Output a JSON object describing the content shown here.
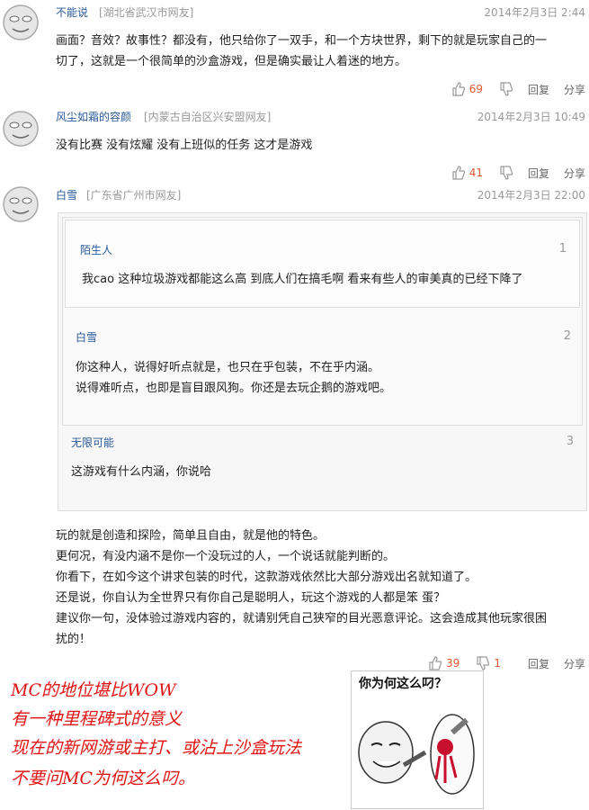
{
  "comments": [
    {
      "user": "不能说",
      "location": "[湖北省武汉市网友]",
      "time": "2014年2月3日 2:44",
      "text_lines": [
        "画面？音效？故事性？都没有，他只给你了一双手，和一个方块世界，剩下的就是玩家自己的一",
        "切了，这就是一个很简单的沙盒游戏，但是确实最让人着迷的地方。"
      ],
      "likes": "69",
      "reply_label": "回复",
      "share_label": "分享"
    },
    {
      "user": "风尘如霜的容颜",
      "location": "[内蒙古自治区兴安盟网友]",
      "time": "2014年2月3日 10:49",
      "text_lines": [
        "没有比赛  没有炫耀  没有上班似的任务  这才是游戏"
      ],
      "likes": "41",
      "reply_label": "回复",
      "share_label": "分享"
    },
    {
      "user": "白雪",
      "location": "[广东省广州市网友]",
      "time": "2014年2月3日 22:00",
      "quotes": [
        {
          "user": "陌生人",
          "num": "1",
          "lines": [
            "我cao 这种垃圾游戏都能这么高 到底人们在搞毛啊 看来有些人的审美真的已经下降了"
          ]
        },
        {
          "user": "白雪",
          "num": "2",
          "lines": [
            "你这种人，说得好听点就是，也只在乎包装，不在乎内涵。",
            "说得难听点，也即是盲目跟风狗。你还是去玩企鹅的游戏吧。"
          ]
        },
        {
          "user": "无限可能",
          "num": "3",
          "lines": [
            "这游戏有什么内涵，你说哈"
          ]
        }
      ],
      "text_lines": [
        "玩的就是创造和探险，简单且自由，就是他的特色。",
        "更何况，有没内涵不是你一个没玩过的人，一个说话就能判断的。",
        "你看下，在如今这个讲求包装的时代，这款游戏依然比大部分游戏出名就知道了。",
        "还是说，你自认为全世界只有你自己是聪明人，玩这个游戏的人都是笨 蛋？",
        "建议你一句，没体验过游戏内容的，就请别凭自己狭窄的目光恶意评论。这会造成其他玩家很困",
        "扰的！"
      ],
      "likes": "39",
      "dislikes": "1",
      "reply_label": "回复",
      "share_label": "分享"
    }
  ],
  "handwriting": [
    "MC的地位堪比WOW",
    "有一种里程碑式的意义",
    "现在的新网游或主打、或沾上沙盒玩法",
    "不要问MC为何这么叼。"
  ],
  "meme_caption": "你为何这么叼？",
  "colors": {
    "accent": "#e4572e",
    "link": "#2a5a9a",
    "handwriting": "#e01414"
  }
}
